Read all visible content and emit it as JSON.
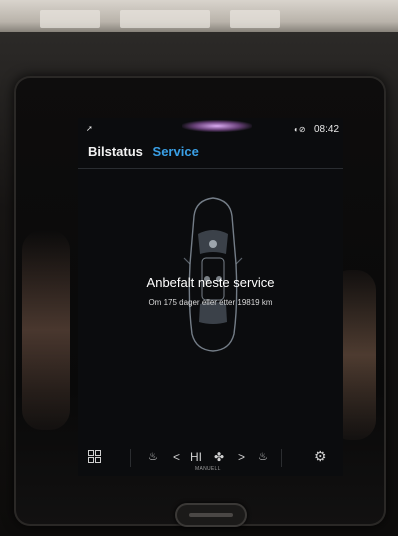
{
  "status_bar": {
    "time": "08:42"
  },
  "tabs": [
    {
      "label": "Bilstatus",
      "active": false
    },
    {
      "label": "Service",
      "active": true
    }
  ],
  "service": {
    "title": "Anbefalt neste service",
    "detail": "Om 175 dager eller etter 19819 km"
  },
  "climate_bar": {
    "fan_level": "HI",
    "fan_mode_label": "MANUELL"
  },
  "colors": {
    "accent": "#3aa0e6",
    "screen_bg": "#0b0c0e",
    "text": "#ffffff"
  },
  "icons": [
    "location-arrow-icon",
    "status-icons",
    "app-grid-icon",
    "heated-seat-left-icon",
    "chevron-left-icon",
    "fan-icon",
    "chevron-right-icon",
    "heated-seat-right-icon",
    "settings-gear-icon",
    "car-topview-icon"
  ]
}
